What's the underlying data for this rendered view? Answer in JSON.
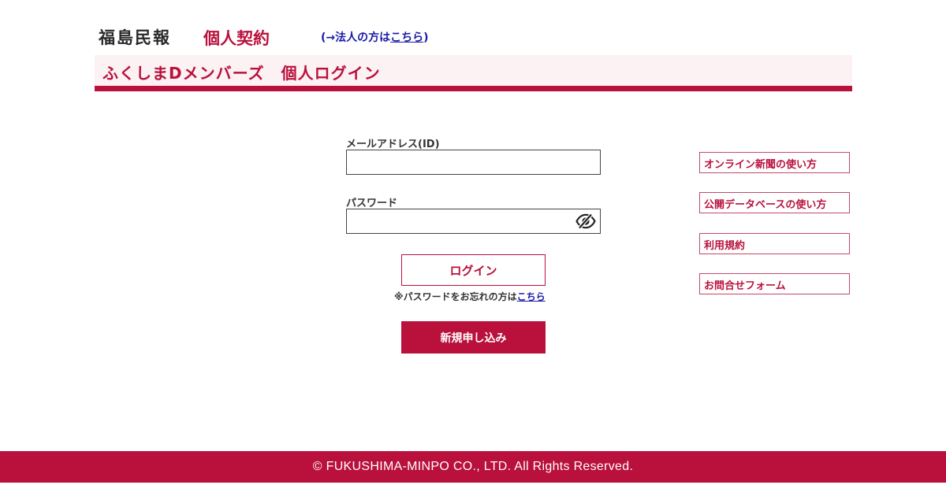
{
  "header": {
    "logo_text": "福島民報",
    "contract_type": "個人契約",
    "corp_link_prefix": "(→法人の方は",
    "corp_link_text": "こちら",
    "corp_link_suffix": ")"
  },
  "title_band": {
    "title": "ふくしまDメンバーズ　個人ログイン"
  },
  "form": {
    "email_label": "メールアドレス(ID)",
    "email_value": "",
    "password_label": "パスワード",
    "password_value": "",
    "login_button": "ログイン",
    "forgot_prefix": "※パスワードをお忘れの方は",
    "forgot_link": "こちら",
    "signup_button": "新規申し込み"
  },
  "side_links": [
    {
      "label": "オンライン新聞の使い方"
    },
    {
      "label": "公開データベースの使い方"
    },
    {
      "label": "利用規約"
    },
    {
      "label": "お問合せフォーム"
    }
  ],
  "footer": {
    "copyright": "© FUKUSHIMA-MINPO CO., LTD. All Rights Reserved."
  },
  "colors": {
    "brand": "#b9103c",
    "title_band_bg": "#fcf1f3",
    "link_blue": "#1a1aa6"
  },
  "icons": {
    "password_toggle": "eye-slash-icon"
  }
}
